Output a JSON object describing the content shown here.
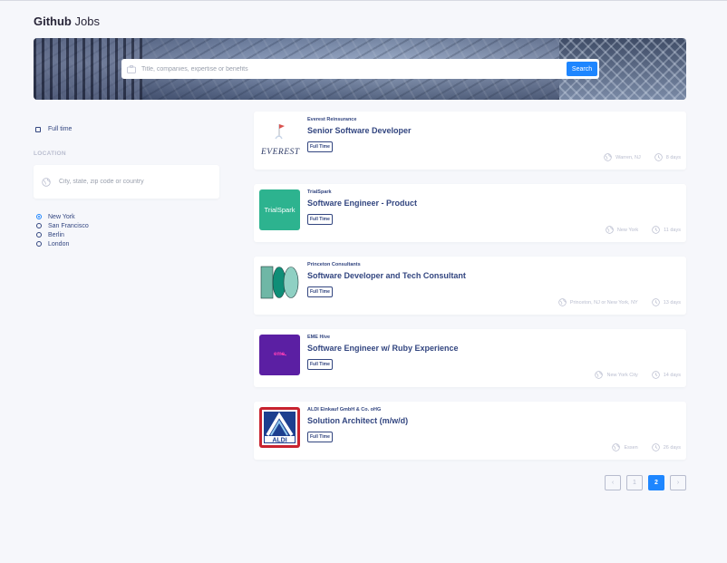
{
  "app": {
    "title_bold": "Github",
    "title_light": "Jobs"
  },
  "search": {
    "placeholder": "Title, companies, expertise or benefits",
    "button_label": "Search"
  },
  "filters": {
    "full_time_label": "Full time",
    "full_time_checked": false,
    "location_label": "LOCATION",
    "location_placeholder": "City, state, zip code or country",
    "cities": [
      {
        "label": "New York",
        "selected": true
      },
      {
        "label": "San Francisco",
        "selected": false
      },
      {
        "label": "Berlin",
        "selected": false
      },
      {
        "label": "London",
        "selected": false
      }
    ]
  },
  "jobs": [
    {
      "company": "Everest Reinsurance",
      "title": "Senior Software Developer",
      "type": "Full Time",
      "location": "Warren, NJ",
      "age": "8 days",
      "logo_text": "EVEREST"
    },
    {
      "company": "TrialSpark",
      "title": "Software Engineer - Product",
      "type": "Full Time",
      "location": "New York",
      "age": "11 days",
      "logo_text": "TrialSpark"
    },
    {
      "company": "Princeton Consultants",
      "title": "Software Developer and Tech Consultant",
      "type": "Full Time",
      "location": "Princeton, NJ or New York, NY",
      "age": "13 days",
      "logo_text": ""
    },
    {
      "company": "EME Hive",
      "title": "Software Engineer w/ Ruby Experience",
      "type": "Full Time",
      "location": "New York City",
      "age": "14 days",
      "logo_text": "eme"
    },
    {
      "company": "ALDI Einkauf GmbH & Co. oHG",
      "title": "Solution Architect (m/w/d)",
      "type": "Full Time",
      "location": "Essen",
      "age": "26 days",
      "logo_text": "ALDI"
    }
  ],
  "pagination": {
    "prev": "‹",
    "pages": [
      "1",
      "2"
    ],
    "current": "2",
    "next": "›"
  },
  "colors": {
    "accent": "#1e86ff",
    "text": "#334680",
    "muted": "#b9bdcf",
    "background": "#f6f7fb"
  }
}
